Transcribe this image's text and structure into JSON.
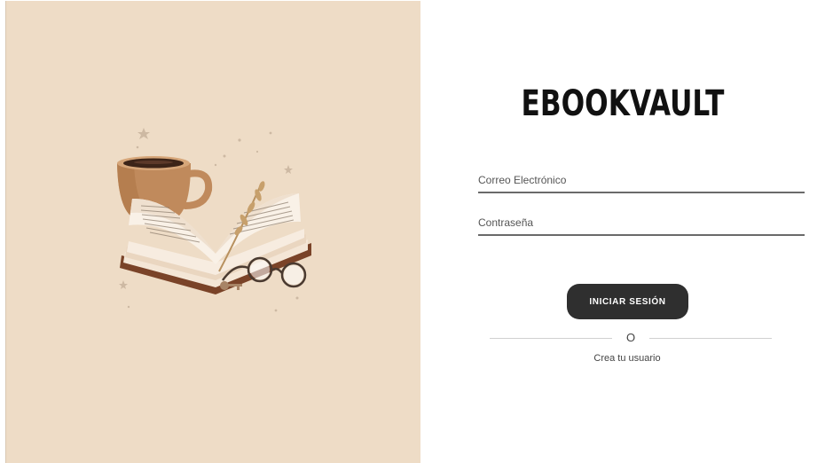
{
  "brand": {
    "title": "EBOOKVAULT"
  },
  "login_form": {
    "email_placeholder": "Correo Electrónico",
    "email_value": "",
    "password_placeholder": "Contraseña",
    "password_value": "",
    "submit_label": "INICIAR SESIÓN",
    "divider_text": "O",
    "signup_link_label": "Crea tu usuario"
  },
  "illustration": {
    "icon": "book-coffee-glasses-illustration"
  },
  "colors": {
    "left_panel_background": "#eedcc6",
    "button_background": "#2f2f2f",
    "button_text": "#ffffff",
    "input_underline": "#6a6a6a"
  }
}
